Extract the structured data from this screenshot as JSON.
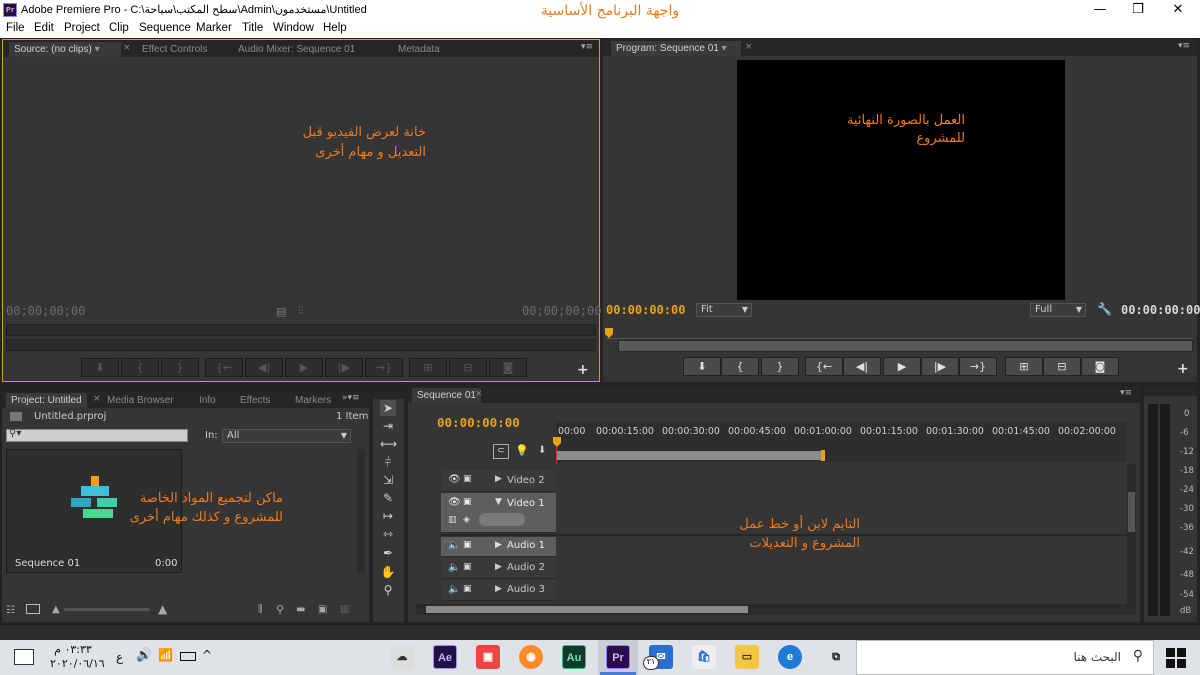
{
  "window": {
    "title": "Adobe Premiere Pro - C:\\سطح المكتب\\سياحة\\Admin\\مستخدمون\\Untitled",
    "minimize": "—",
    "maximize": "❐",
    "close": "✕"
  },
  "annotations": {
    "header": "واجهة البرنامج الأساسية",
    "source_line1": "خانة لعرض الفيديو قبل",
    "source_line2": "التعديل و مهام أخرى",
    "program_line1": "العمل بالصورة النهائية",
    "program_line2": "للمشروع",
    "project_line1": "ماكن لتجميع المواد الخاصة",
    "project_line2": "للمشروع و كذلك مهام أخرى",
    "timeline_line1": "التايم لاين أو خط عمل",
    "timeline_line2": "المشروع و التعديلات"
  },
  "menu": [
    "File",
    "Edit",
    "Project",
    "Clip",
    "Sequence",
    "Marker",
    "Title",
    "Window",
    "Help"
  ],
  "source_panel": {
    "tabs": [
      "Source: (no clips)",
      "Effect Controls",
      "Audio Mixer: Sequence 01",
      "Metadata"
    ],
    "timecode_left": "00;00;00;00",
    "timecode_right": "00;00;00;00"
  },
  "program_panel": {
    "tab": "Program: Sequence 01",
    "timecode_left": "00:00:00:00",
    "timecode_right": "00:00:00:00",
    "fit": "Fit",
    "quality": "Full"
  },
  "project_panel": {
    "tabs": [
      "Project: Untitled",
      "Media Browser",
      "Info",
      "Effects",
      "Markers"
    ],
    "file": "Untitled.prproj",
    "count": "1 Item",
    "in_label": "In:",
    "in_value": "All",
    "item_name": "Sequence 01",
    "item_duration": "0:00"
  },
  "timeline": {
    "tab": "Sequence 01",
    "timecode": "00:00:00:00",
    "ruler": [
      "00:00",
      "00:00:15:00",
      "00:00:30:00",
      "00:00:45:00",
      "00:01:00:00",
      "00:01:15:00",
      "00:01:30:00",
      "00:01:45:00",
      "00:02:00:00"
    ],
    "tracks": {
      "video2": "Video 2",
      "video1": "Video 1",
      "audio1": "Audio 1",
      "audio2": "Audio 2",
      "audio3": "Audio 3"
    }
  },
  "meter": {
    "labels": [
      "0",
      "-6",
      "-12",
      "-18",
      "-24",
      "-30",
      "-36",
      "-42",
      "-48",
      "-54",
      "dB"
    ]
  },
  "taskbar": {
    "time": "٠٣:٣٣ م",
    "date": "٢٠٢٠/٠٦/١٦",
    "lang": "ع",
    "search": "البحث هنا",
    "apps": [
      "Ae",
      "Au",
      "Pr"
    ],
    "notif_count": "٢١"
  },
  "colors": {
    "accent_orange": "#e8a21a",
    "annotation": "#f07a1a",
    "panel_bg": "#353535",
    "app_bg": "#232323"
  }
}
